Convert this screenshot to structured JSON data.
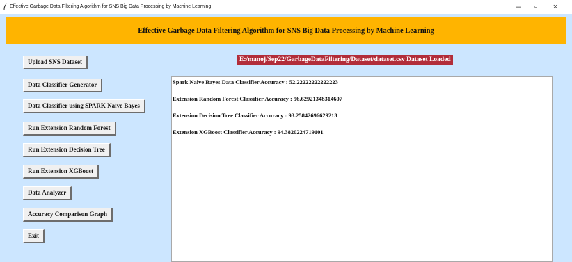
{
  "window": {
    "title": "Effective Garbage Data Filtering Algorithm for SNS Big Data Processing by Machine Learning",
    "controls": {
      "minimize": "–",
      "maximize": "▫",
      "close": "×"
    }
  },
  "header": {
    "title": "Effective Garbage Data Filtering Algorithm for SNS Big Data Processing by Machine Learning"
  },
  "status_text": "E:/manoj/Sep22/GarbageDataFiltering/Dataset/dataset.csv Dataset Loaded",
  "buttons": [
    "Upload SNS Dataset",
    "Data Classifier Generator",
    "Data Classifier using SPARK Naive Bayes",
    "Run Extension Random Forest",
    "Run Extension Decision Tree",
    "Run Extension XGBoost",
    "Data Analyzer",
    "Accuracy Comparison Graph",
    "Exit"
  ],
  "output_lines": [
    "Spark Naive Bayes Data Classifier Accuracy : 52.22222222222223",
    "Extension Random Forest Classifier Accuracy : 96.62921348314607",
    "Extension Decision Tree Classifier Accuracy : 93.25842696629213",
    "Extension XGBoost Classifier Accuracy : 94.3820224719101"
  ],
  "colors": {
    "client_background": "#cce6ff",
    "header_background": "#ffb400",
    "status_background": "#b22d3a",
    "button_face": "#f0f0f0"
  }
}
